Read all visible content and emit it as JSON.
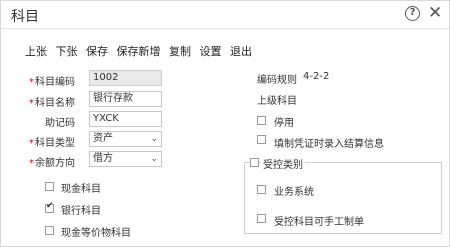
{
  "window": {
    "title": "科目"
  },
  "toolbar": {
    "prev": "上张",
    "next": "下张",
    "save": "保存",
    "save_new": "保存新增",
    "copy": "复制",
    "settings": "设置",
    "exit": "退出"
  },
  "form": {
    "code": {
      "label": "科目编码",
      "value": "1002",
      "required": true
    },
    "name": {
      "label": "科目名称",
      "value": "银行存款",
      "required": true
    },
    "mnemonic": {
      "label": "助记码",
      "value": "YXCK"
    },
    "type": {
      "label": "科目类型",
      "value": "资产",
      "required": true
    },
    "direction": {
      "label": "余额方向",
      "value": "借方",
      "required": true
    }
  },
  "info": {
    "code_rule_label": "编码规则",
    "code_rule_value": "4-2-2",
    "parent_label": "上级科目"
  },
  "left_checkboxes": [
    {
      "label": "现金科目",
      "checked": false
    },
    {
      "label": "银行科目",
      "checked": true
    },
    {
      "label": "现金等价物科目",
      "checked": false
    }
  ],
  "right_checkboxes": [
    {
      "label": "停用",
      "checked": false
    },
    {
      "label": "填制凭证时录入结算信息",
      "checked": false
    }
  ],
  "controlled": {
    "title": "受控类别",
    "checked": false,
    "items": [
      {
        "label": "业务系统",
        "checked": false
      },
      {
        "label": "受控科目可手工制单",
        "checked": false
      }
    ]
  }
}
